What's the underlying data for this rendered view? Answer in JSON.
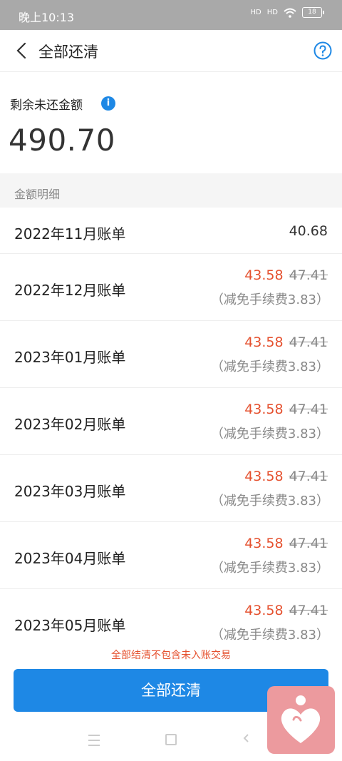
{
  "status_bar": {
    "time": "晚上10:13",
    "sig1": "HD",
    "sig2": "HD",
    "battery": "18"
  },
  "header": {
    "title": "全部还清"
  },
  "balance": {
    "label": "剩余未还金额",
    "info_glyph": "i",
    "amount": "490.70"
  },
  "section": {
    "title": "金额明细"
  },
  "bills": [
    {
      "label": "2022年11月账单",
      "amount": "40.68"
    },
    {
      "label": "2022年12月账单",
      "amount": "43.58",
      "original": "47.41",
      "waiver": "（减免手续费3.83）"
    },
    {
      "label": "2023年01月账单",
      "amount": "43.58",
      "original": "47.41",
      "waiver": "（减免手续费3.83）"
    },
    {
      "label": "2023年02月账单",
      "amount": "43.58",
      "original": "47.41",
      "waiver": "（减免手续费3.83）"
    },
    {
      "label": "2023年03月账单",
      "amount": "43.58",
      "original": "47.41",
      "waiver": "（减免手续费3.83）"
    },
    {
      "label": "2023年04月账单",
      "amount": "43.58",
      "original": "47.41",
      "waiver": "（减免手续费3.83）"
    },
    {
      "label": "2023年05月账单",
      "amount": "43.58",
      "original": "47.41",
      "waiver": "（减免手续费3.83）"
    }
  ],
  "footer": {
    "notice": "全部结清不包含未入账交易",
    "button": "全部还清"
  },
  "icons": {
    "back": "back-chevron-icon",
    "help": "help-icon",
    "info": "info-icon",
    "heart": "heart-icon"
  },
  "colors": {
    "accent": "#1e88e5",
    "discount": "#e5512f",
    "heart_bg": "#ec9a9e"
  }
}
